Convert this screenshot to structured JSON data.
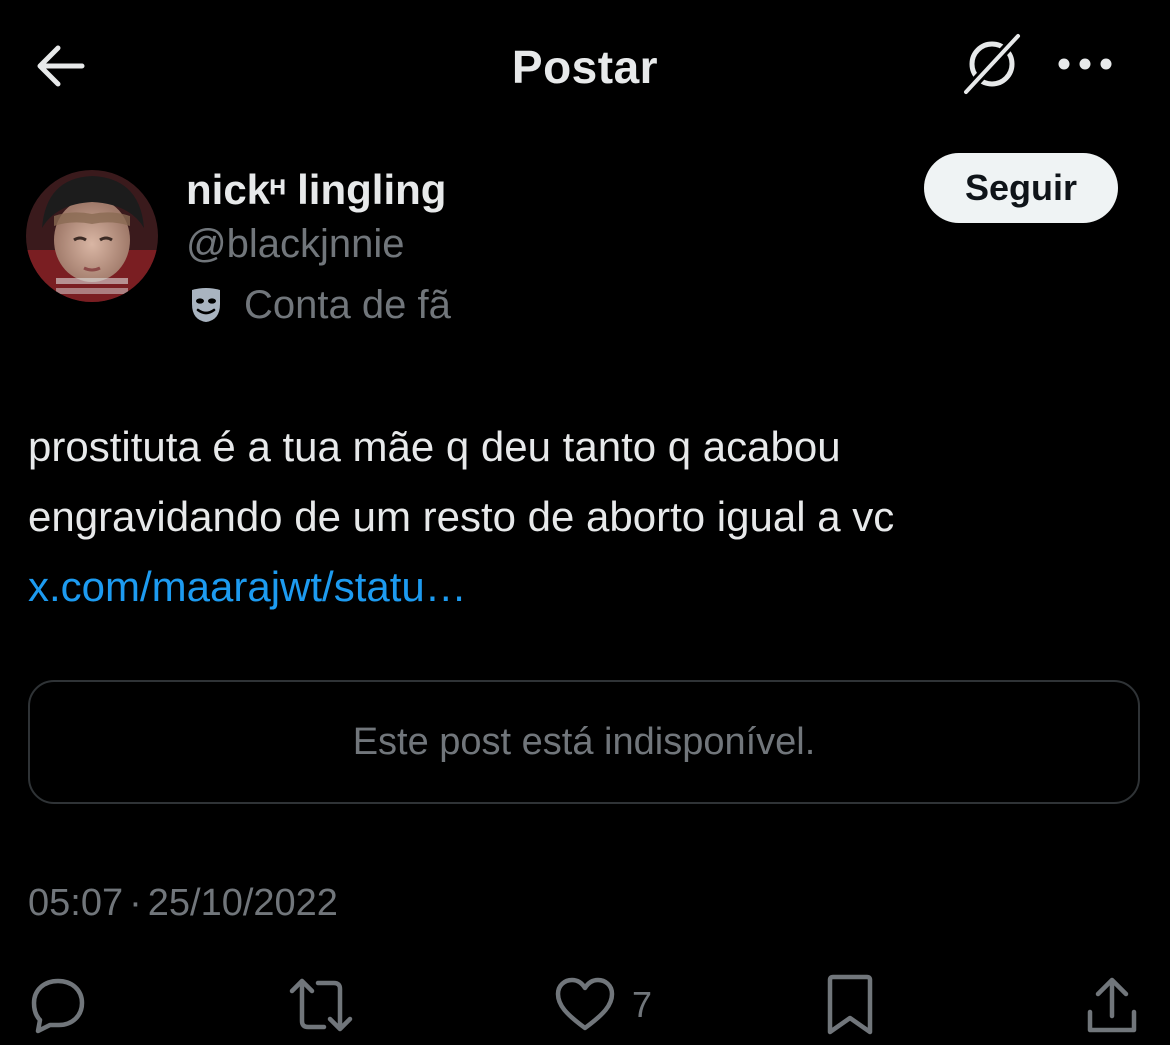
{
  "header": {
    "title": "Postar",
    "back_icon": "arrow-left-icon",
    "grok_icon": "grok-icon",
    "more_icon": "more-dots-icon"
  },
  "author": {
    "display_name": "nickᵸ lingling",
    "handle": "@blackjnnie",
    "fan_label": "Conta de fã",
    "fan_icon": "theater-mask-icon",
    "follow_label": "Seguir"
  },
  "post": {
    "line1": "prostituta é a tua mãe q deu tanto q acabou",
    "line2": "engravidando de um resto de aborto igual a vc",
    "link": "x.com/maarajwt/statu…"
  },
  "quoted": {
    "unavailable_text": "Este post está indisponível."
  },
  "meta": {
    "time": "05:07",
    "separator": "·",
    "date": "25/10/2022"
  },
  "actions": {
    "reply_icon": "reply-icon",
    "repost_icon": "repost-icon",
    "like_icon": "heart-icon",
    "like_count": "7",
    "bookmark_icon": "bookmark-icon",
    "share_icon": "share-icon"
  },
  "colors": {
    "background": "#000000",
    "text": "#e7e9ea",
    "secondary": "#71767b",
    "link": "#1d9bf0",
    "border": "#2f3336",
    "follow_bg": "#eff3f4"
  }
}
